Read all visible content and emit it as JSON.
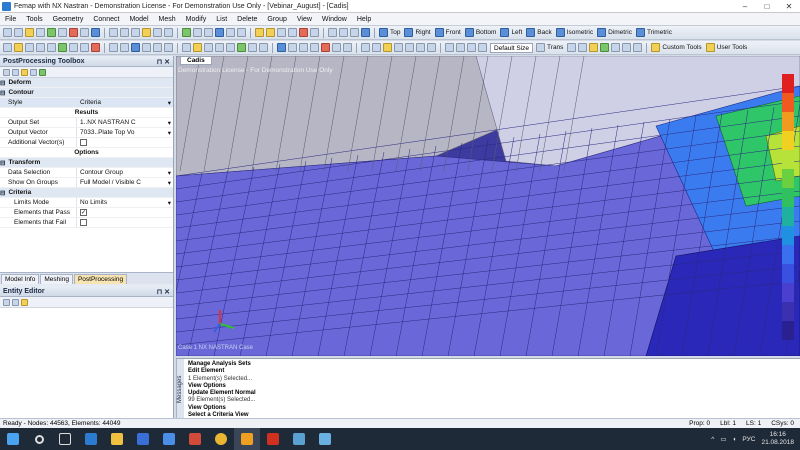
{
  "window": {
    "title": "Femap with NX Nastran - Demonstration License - For Demonstration Use Only - [Vebinar_August] - [Cadis]"
  },
  "menu": [
    "File",
    "Tools",
    "Geometry",
    "Connect",
    "Model",
    "Mesh",
    "Modify",
    "List",
    "Delete",
    "Group",
    "View",
    "Window",
    "Help"
  ],
  "toolbar": {
    "view_buttons": [
      "Top",
      "Right",
      "Front",
      "Bottom",
      "Left",
      "Back",
      "Isometric",
      "Dimetric",
      "Trimetric"
    ],
    "default_size": "Default Size",
    "trans": "Trans",
    "custom_tools": "Custom Tools",
    "user_tools": "User Tools"
  },
  "pp_toolbox": {
    "title": "PostProcessing Toolbox",
    "rows": [
      {
        "k": "Deform",
        "v": "",
        "kind": "cat"
      },
      {
        "k": "Contour",
        "v": "",
        "kind": "cat"
      },
      {
        "k": "Style",
        "v": "Criteria",
        "kind": "sel"
      },
      {
        "k": "Results",
        "v": "",
        "kind": "sub"
      },
      {
        "k": "Output Set",
        "v": "1..NX NASTRAN C",
        "kind": "norm"
      },
      {
        "k": "Output Vector",
        "v": "7033..Plate Top Vo",
        "kind": "norm"
      },
      {
        "k": "Additional Vector(s)",
        "v": "",
        "kind": "chk"
      },
      {
        "k": "Options",
        "v": "",
        "kind": "sub"
      },
      {
        "k": "Transform",
        "v": "",
        "kind": "cat"
      },
      {
        "k": "Data Selection",
        "v": "Contour Group",
        "kind": "norm"
      },
      {
        "k": "Show On Groups",
        "v": "Full Model / Visible C",
        "kind": "norm"
      },
      {
        "k": "Criteria",
        "v": "",
        "kind": "cat"
      },
      {
        "k": "Limits Mode",
        "v": "No Limits",
        "kind": "indent"
      },
      {
        "k": "Elements that Pass",
        "v": "✓",
        "kind": "indentchk"
      },
      {
        "k": "Elements that Fail",
        "v": "",
        "kind": "indentchk"
      }
    ],
    "tabs": [
      "Model Info",
      "Meshing",
      "PostProcessing"
    ]
  },
  "entity_editor": {
    "title": "Entity Editor"
  },
  "viewport": {
    "tab": "Cadis",
    "watermark": "Demonstration License - For Demonstration Use Only",
    "subtitle": "Case 1 NX NASTRAN Case"
  },
  "messages": {
    "side_label": "Messages",
    "lines": [
      {
        "t": "Manage Analysis Sets",
        "b": true
      },
      {
        "t": "Edit Element",
        "b": true
      },
      {
        "t": "1 Element(s) Selected...",
        "b": false
      },
      {
        "t": "View Options",
        "b": true
      },
      {
        "t": "Update Element Normal",
        "b": true
      },
      {
        "t": "99 Element(s) Selected...",
        "b": false
      },
      {
        "t": "View Options",
        "b": true
      },
      {
        "t": "Select a Criteria View",
        "b": true
      }
    ]
  },
  "status": {
    "left": "Ready - Nodes: 44563, Elements: 44049",
    "prop": "Prop: 0",
    "lbl": "Lbl: 1",
    "ls": "LS: 1",
    "csys": "CSys: 0"
  },
  "taskbar": {
    "lang": "РУС",
    "time": "16:16",
    "date": "21.08.2018"
  },
  "colors": {
    "viewport_bg": "#3d3aa0",
    "accent": "#2b7bd0"
  }
}
